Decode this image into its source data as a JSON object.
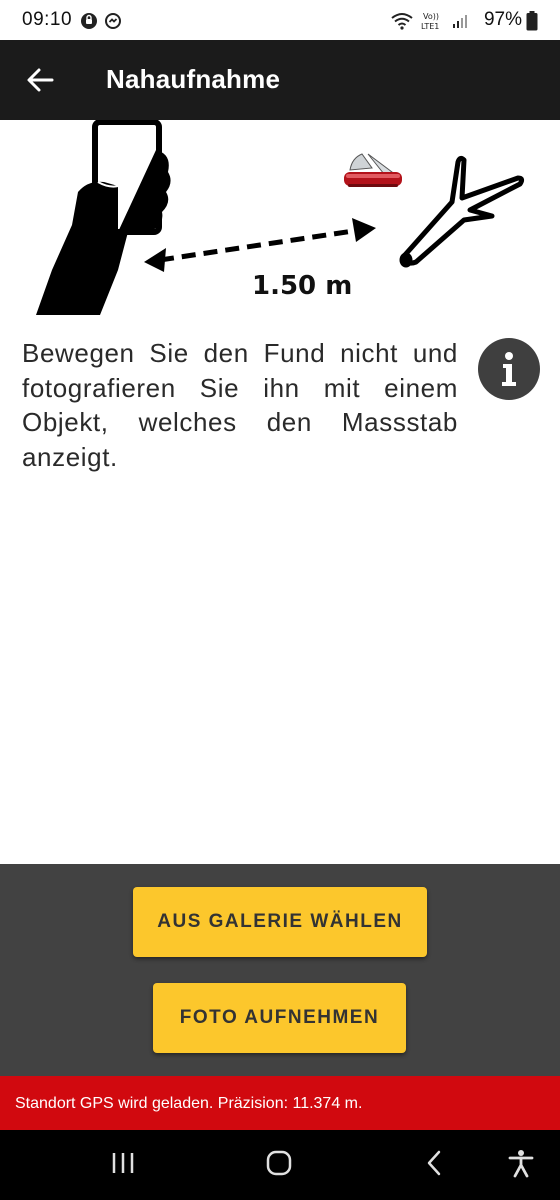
{
  "status_bar": {
    "time": "09:10",
    "battery": "97%",
    "network": "LTE1",
    "left_icons": [
      "chat-icon",
      "messenger-icon"
    ],
    "right_icons": [
      "wifi-icon",
      "volte-icon",
      "signal-icon",
      "battery-icon"
    ]
  },
  "app_bar": {
    "title": "Nahaufnahme",
    "back_icon": "arrow-left-icon"
  },
  "illustration": {
    "distance_label": "1.50 m",
    "icons": [
      "hand-phone-icon",
      "double-arrow-icon",
      "pocket-knife-icon",
      "branch-icon"
    ]
  },
  "instruction": {
    "text": "Bewegen Sie den Fund nicht und fotografieren Sie ihn mit einem Objekt, welches den Massstab anzeigt.",
    "info_icon": "info-icon"
  },
  "actions": {
    "gallery_label": "AUS GALERIE WÄHLEN",
    "photo_label": "FOTO AUFNEHMEN"
  },
  "gps_banner": {
    "text": "Standort GPS wird geladen. Präzision: 11.374 m."
  },
  "nav_bar": {
    "icons": [
      "recents-icon",
      "home-icon",
      "back-icon",
      "accessibility-icon"
    ]
  },
  "colors": {
    "app_bar": "#1b1b1b",
    "accent_button": "#fcc72c",
    "panel": "#424242",
    "gps_banner": "#d1090f",
    "info_button": "#3f3f3f"
  }
}
